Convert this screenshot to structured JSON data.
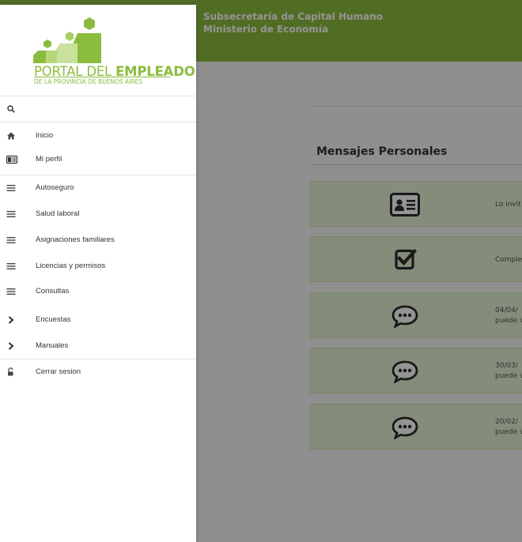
{
  "header": {
    "org_line1": "Subsecretaría de Capital Humano",
    "org_line2": "Ministerio de Economía"
  },
  "main": {
    "section_title": "Mensajes Personales",
    "messages": [
      {
        "icon": "id-card-icon",
        "text_line1": "Lo invit",
        "text_line2": ""
      },
      {
        "icon": "checkbox-checked-icon",
        "text_line1": "Comple",
        "text_line2": ""
      },
      {
        "icon": "chat-bubble-icon",
        "text_line1": "04/04/",
        "text_line2": "puede v"
      },
      {
        "icon": "chat-bubble-icon",
        "text_line1": "30/03/",
        "text_line2": "puede v"
      },
      {
        "icon": "chat-bubble-icon",
        "text_line1": "20/02/",
        "text_line2": "puede v"
      }
    ]
  },
  "drawer": {
    "logo": {
      "brand_light": "PORTAL DEL ",
      "brand_bold": "EMPLEADO",
      "subtitle": "DE LA PROVINCIA DE BUENOS AIRES"
    },
    "search": {
      "value": "",
      "placeholder": ""
    },
    "items": [
      {
        "label": "Inicio",
        "icon": "home-icon"
      },
      {
        "label": "Mi perfil",
        "icon": "id-card-icon"
      },
      {
        "label": "Autoseguro",
        "icon": "menu-lines-icon"
      },
      {
        "label": "Salud laboral",
        "icon": "menu-lines-icon"
      },
      {
        "label": "Asignaciones familiares",
        "icon": "menu-lines-icon"
      },
      {
        "label": "Licencias y permisos",
        "icon": "menu-lines-icon"
      },
      {
        "label": "Consultas",
        "icon": "menu-lines-icon"
      },
      {
        "label": "Encuestas",
        "icon": "chevron-right-icon"
      },
      {
        "label": "Manuales",
        "icon": "chevron-right-icon"
      },
      {
        "label": "Cerrar sesion",
        "icon": "unlock-icon"
      }
    ]
  },
  "colors": {
    "brand_green": "#8cbc3f",
    "message_bg": "#e3f1d2",
    "overlay": "rgba(0,0,0,0.42)"
  }
}
